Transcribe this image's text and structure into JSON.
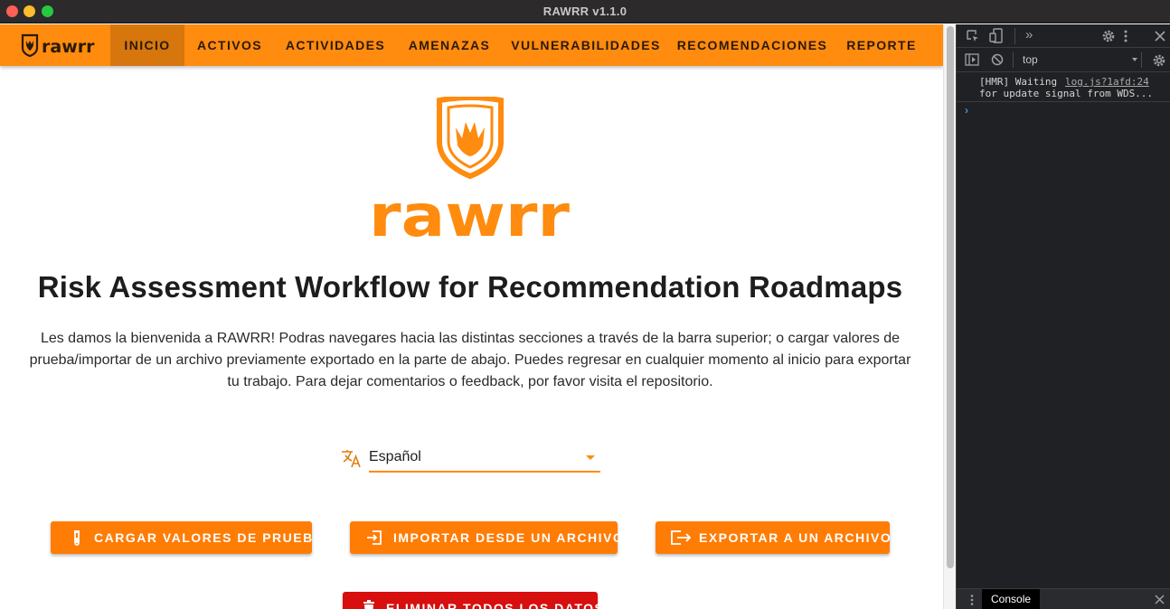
{
  "window": {
    "title": "RAWRR v1.1.0"
  },
  "nav": {
    "logo_text": "rawrr",
    "items": [
      {
        "label": "INICIO",
        "active": true
      },
      {
        "label": "ACTIVOS",
        "active": false
      },
      {
        "label": "ACTIVIDADES",
        "active": false
      },
      {
        "label": "AMENAZAS",
        "active": false
      },
      {
        "label": "VULNERABILIDADES",
        "active": false
      },
      {
        "label": "RECOMENDACIONES",
        "active": false
      },
      {
        "label": "REPORTE",
        "active": false
      }
    ]
  },
  "hero": {
    "logo_text": "rawrr"
  },
  "main": {
    "title": "Risk Assessment Workflow for Recommendation Roadmaps",
    "intro": "Les damos la bienvenida a RAWRR! Podras navegares hacia las distintas secciones a través de la barra superior; o cargar valores de prueba/importar de un archivo previamente exportado en la parte de abajo. Puedes regresar en cualquier momento al inicio para exportar tu trabajo. Para dejar comentarios o feedback, por favor visita el repositorio."
  },
  "language": {
    "value": "Español",
    "icon": "translate-icon"
  },
  "actions": {
    "load_test": "CARGAR VALORES DE PRUEBA",
    "import": "IMPORTAR DESDE UN ARCHIVO",
    "export": "EXPORTAR A UN ARCHIVO",
    "delete_all": "ELIMINAR TODOS LOS DATOS"
  },
  "devtools": {
    "context": "top",
    "log_text_1": "[HMR] Waiting",
    "log_text_2": "for update signal from WDS...",
    "log_link": "log.js?1afd:24",
    "prompt": "›",
    "tab": "Console"
  },
  "colors": {
    "brand": "#ff8b0f",
    "button": "#ff7c05",
    "danger": "#d70f0f",
    "nav_active": "#d6760d",
    "devtools_bg": "#202124"
  }
}
